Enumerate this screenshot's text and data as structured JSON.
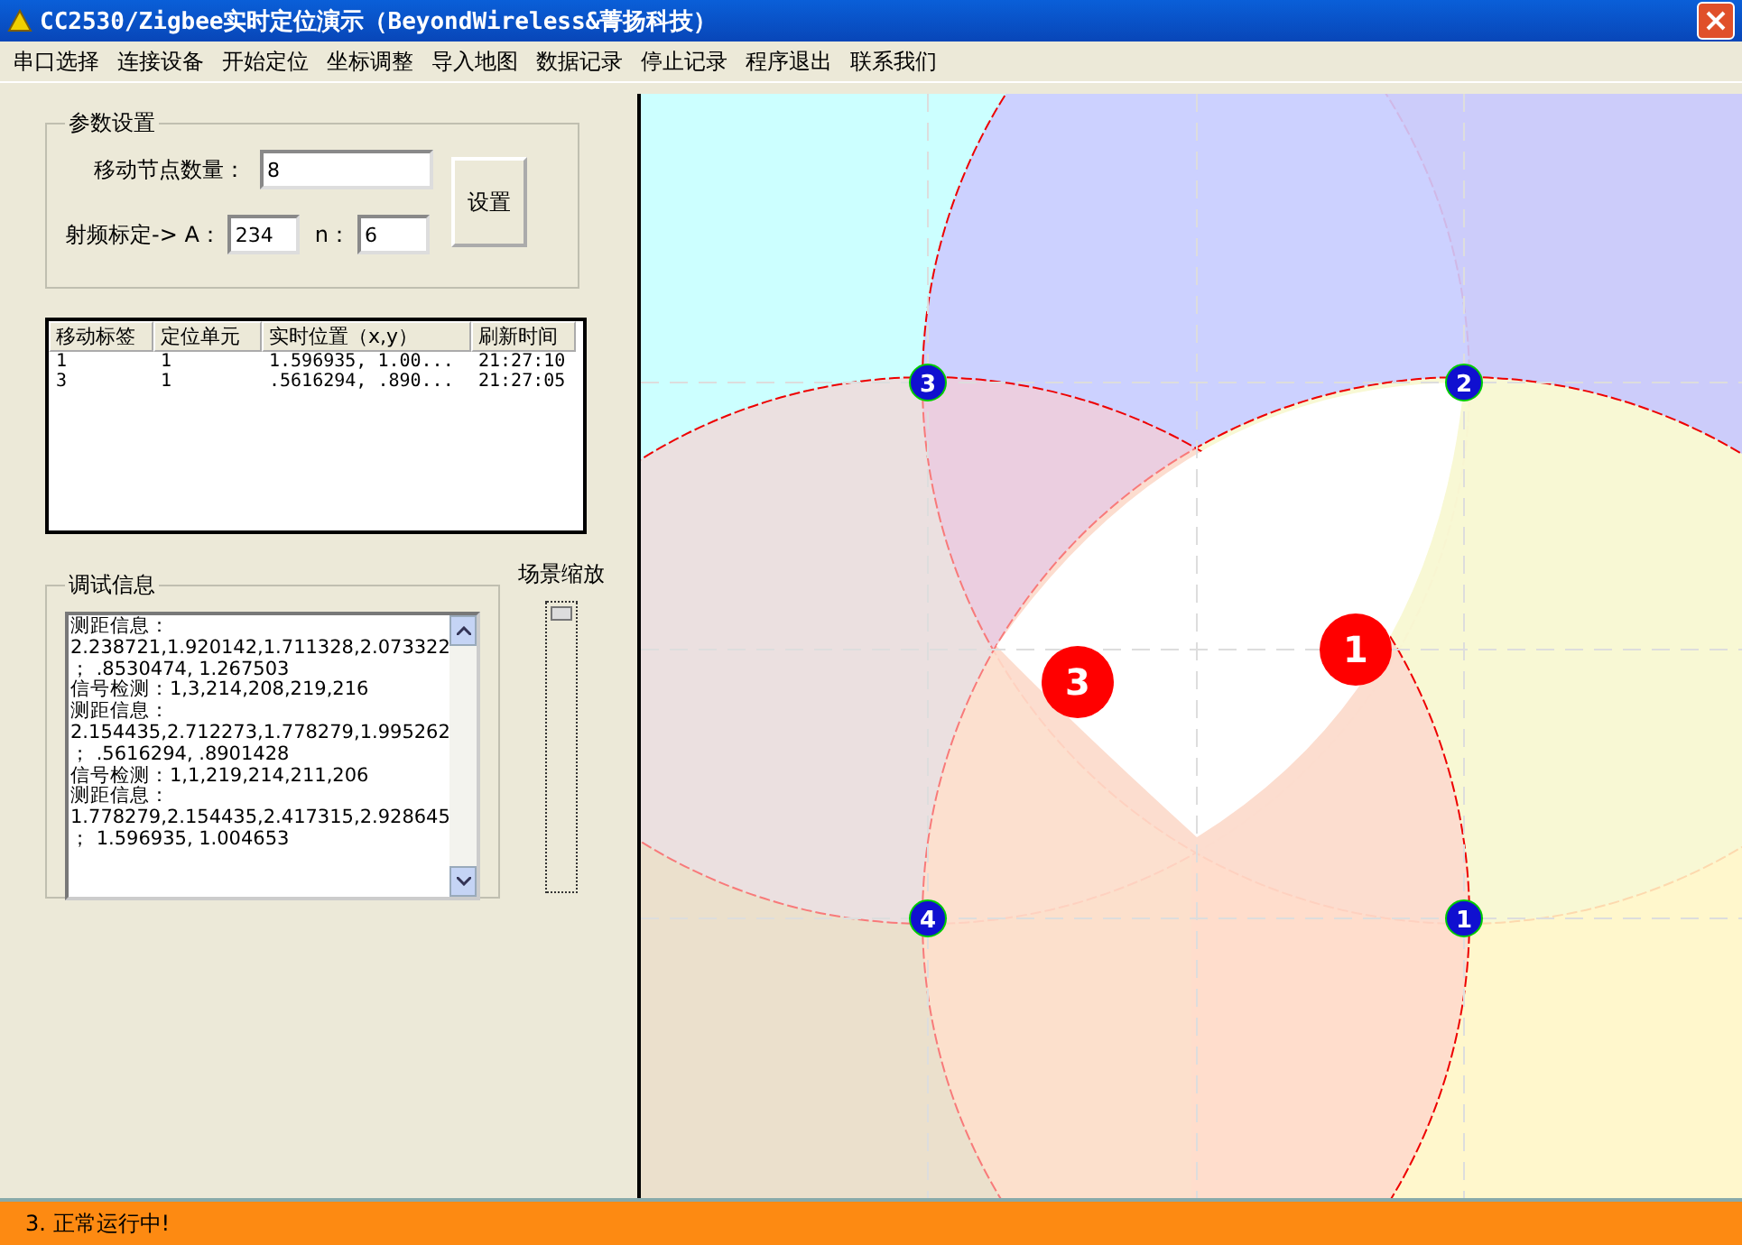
{
  "window": {
    "title": "CC2530/Zigbee实时定位演示（BeyondWireless&菁扬科技）"
  },
  "menu": [
    "串口选择",
    "连接设备",
    "开始定位",
    "坐标调整",
    "导入地图",
    "数据记录",
    "停止记录",
    "程序退出",
    "联系我们"
  ],
  "params": {
    "title": "参数设置",
    "count_label": "移动节点数量：",
    "count_value": "8",
    "rf_label": "射频标定-> A：",
    "a_value": "234",
    "n_label": "n：",
    "n_value": "6",
    "button": "设置"
  },
  "table": {
    "columns": [
      "移动标签",
      "定位单元",
      "实时位置（x,y）",
      "刷新时间"
    ],
    "rows": [
      [
        "1",
        "1",
        "1.596935,  1.00...",
        "21:27:10"
      ],
      [
        "3",
        "1",
        ".5616294,  .890...",
        "21:27:05"
      ]
    ]
  },
  "debug": {
    "title": "调试信息",
    "lines": [
      "测距信息：",
      "2.238721,1.920142,1.711328,2.073322",
      "；  .8530474,  1.267503",
      "信号检测：1,3,214,208,219,216",
      "测距信息：",
      "2.154435,2.712273,1.778279,1.995262",
      "；  .5616294,  .8901428",
      "信号检测：1,1,219,214,211,206",
      "测距信息：",
      "1.778279,2.154435,2.417315,2.928645",
      "；  1.596935,  1.004653"
    ]
  },
  "zoom": {
    "label": "场景缩放",
    "level": 1
  },
  "map": {
    "anchors": [
      "3",
      "2",
      "4",
      "1"
    ],
    "tags": [
      "1",
      "3"
    ]
  },
  "status_bar": "3. 正常运行中!"
}
